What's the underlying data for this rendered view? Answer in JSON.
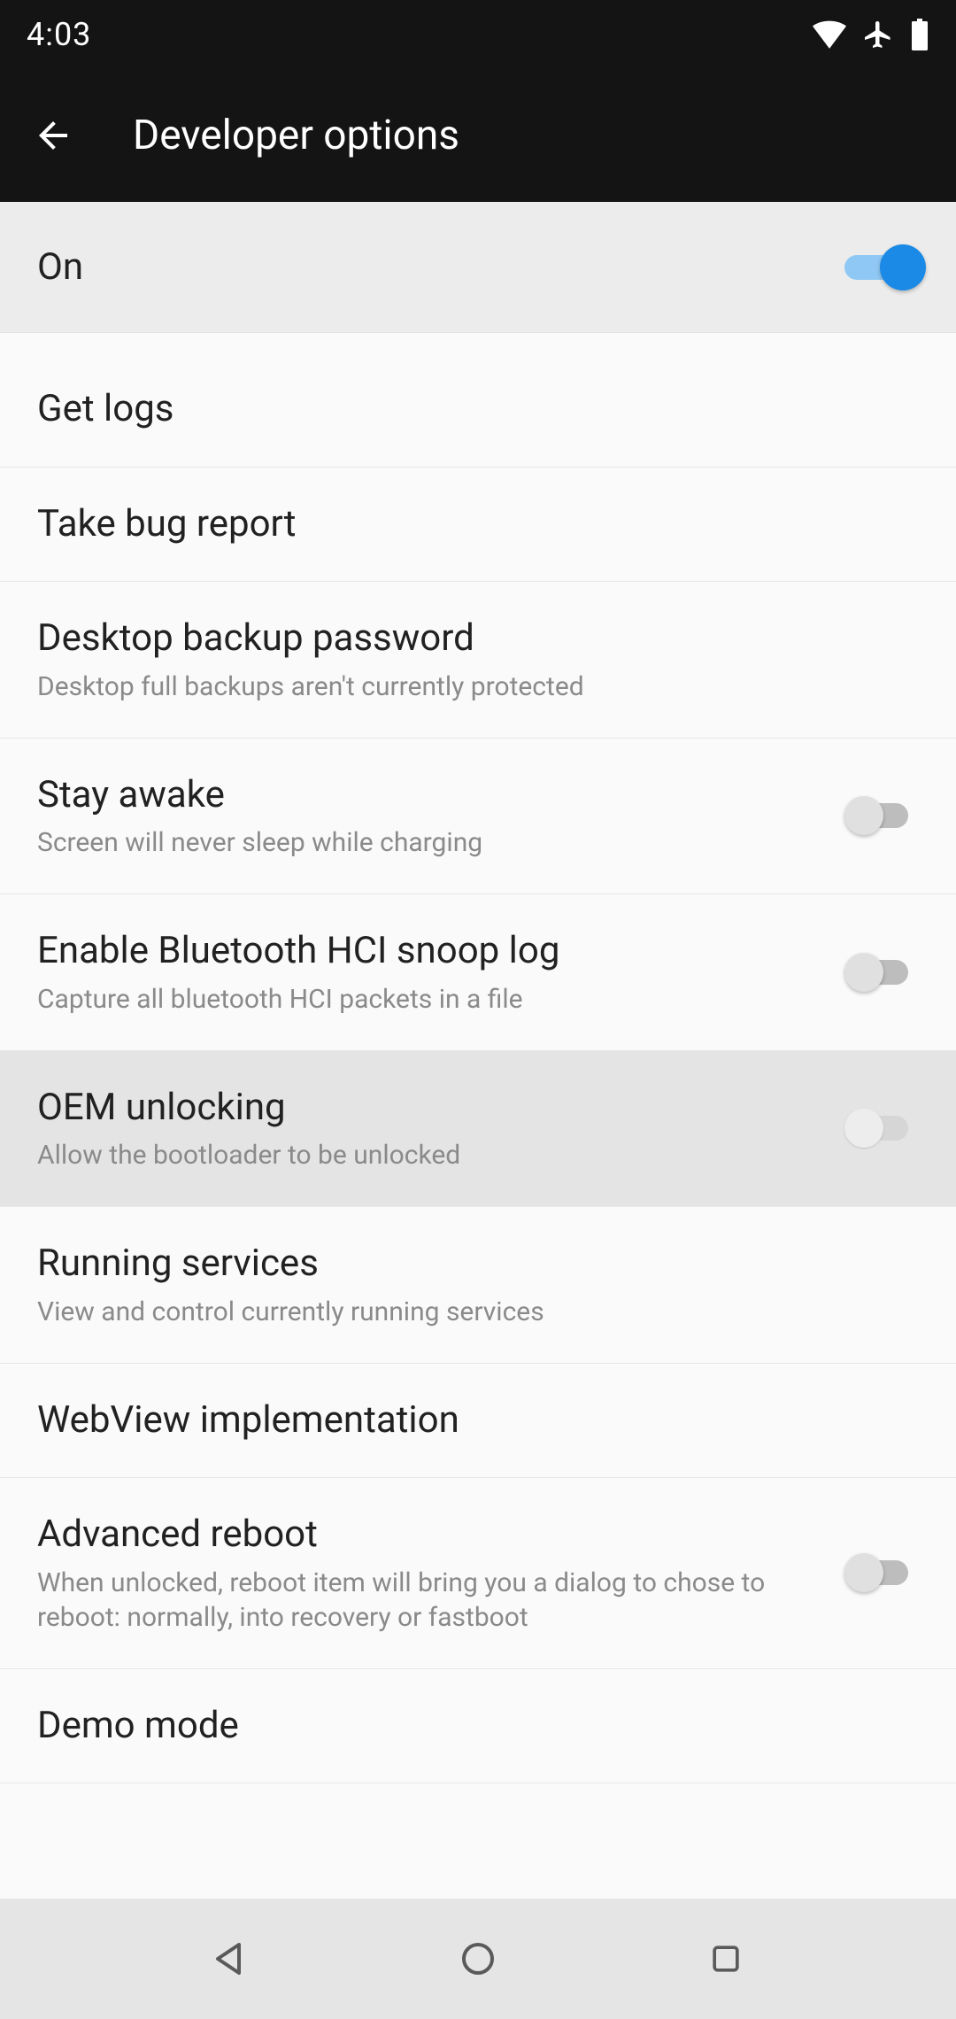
{
  "statusbar": {
    "time": "4:03"
  },
  "appbar": {
    "title": "Developer options"
  },
  "master": {
    "label": "On",
    "enabled": true
  },
  "items": [
    {
      "title": "Get logs",
      "sub": "",
      "toggle": null,
      "highlight": false
    },
    {
      "title": "Take bug report",
      "sub": "",
      "toggle": null,
      "highlight": false
    },
    {
      "title": "Desktop backup password",
      "sub": "Desktop full backups aren't currently protected",
      "toggle": null,
      "highlight": false
    },
    {
      "title": "Stay awake",
      "sub": "Screen will never sleep while charging",
      "toggle": false,
      "highlight": false
    },
    {
      "title": "Enable Bluetooth HCI snoop log",
      "sub": "Capture all bluetooth HCI packets in a file",
      "toggle": false,
      "highlight": false
    },
    {
      "title": "OEM unlocking",
      "sub": "Allow the bootloader to be unlocked",
      "toggle": false,
      "highlight": true,
      "disabled": true
    },
    {
      "title": "Running services",
      "sub": "View and control currently running services",
      "toggle": null,
      "highlight": false
    },
    {
      "title": "WebView implementation",
      "sub": "",
      "toggle": null,
      "highlight": false
    },
    {
      "title": "Advanced reboot",
      "sub": "When unlocked, reboot item will bring you a dialog to chose to reboot: normally, into recovery or fastboot",
      "toggle": false,
      "highlight": false
    },
    {
      "title": "Demo mode",
      "sub": "",
      "toggle": null,
      "highlight": false
    }
  ]
}
